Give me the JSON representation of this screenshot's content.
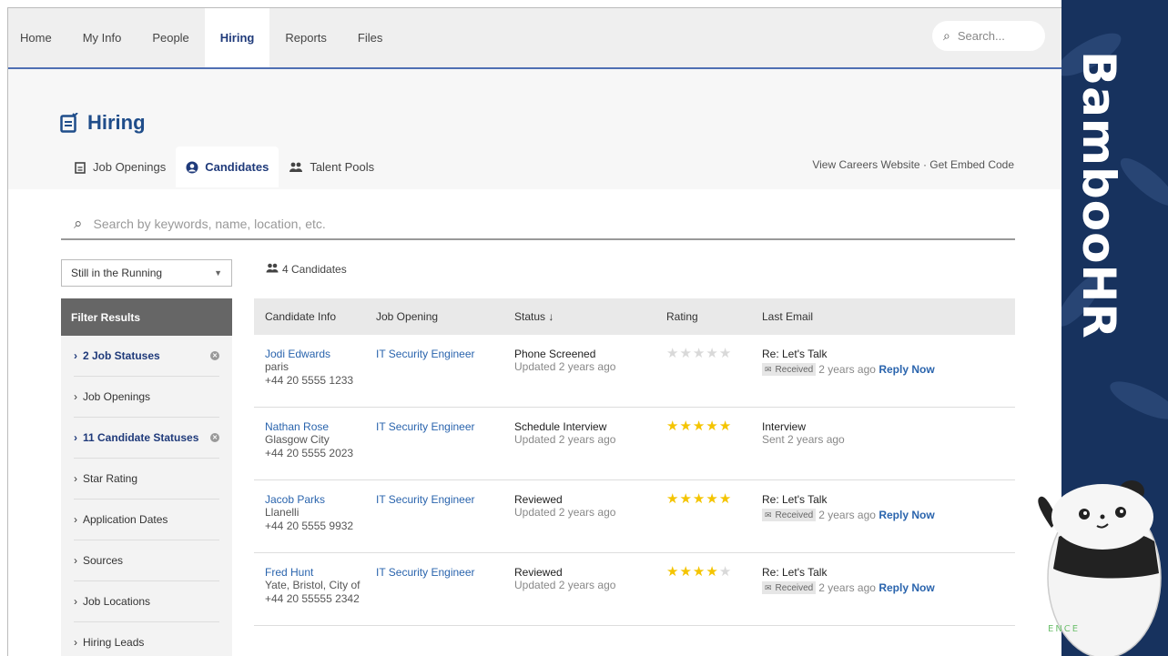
{
  "nav": {
    "items": [
      "Home",
      "My Info",
      "People",
      "Hiring",
      "Reports",
      "Files"
    ],
    "active": "Hiring",
    "search_placeholder": "Search..."
  },
  "page": {
    "title": "Hiring",
    "tabs": [
      {
        "label": "Job Openings",
        "icon": "job-openings-icon"
      },
      {
        "label": "Candidates",
        "icon": "candidate-icon"
      },
      {
        "label": "Talent Pools",
        "icon": "talent-pools-icon"
      }
    ],
    "active_tab": "Candidates",
    "link_careers": "View Careers Website",
    "link_separator": "·",
    "link_embed": "Get Embed Code"
  },
  "search": {
    "placeholder": "Search by keywords, name, location, etc."
  },
  "filter": {
    "dropdown_value": "Still in the Running",
    "header": "Filter Results",
    "items": [
      {
        "label": "2 Job Statuses",
        "active": true
      },
      {
        "label": "Job Openings",
        "active": false
      },
      {
        "label": "11 Candidate Statuses",
        "active": true
      },
      {
        "label": "Star Rating",
        "active": false
      },
      {
        "label": "Application Dates",
        "active": false
      },
      {
        "label": "Sources",
        "active": false
      },
      {
        "label": "Job Locations",
        "active": false
      },
      {
        "label": "Hiring Leads",
        "active": false
      }
    ]
  },
  "candidates": {
    "count_label": "4 Candidates",
    "columns": [
      "Candidate Info",
      "Job Opening",
      "Status ↓",
      "Rating",
      "Last Email"
    ],
    "rows": [
      {
        "name": "Jodi Edwards",
        "location": "paris",
        "phone": "+44 20 5555 1233",
        "job": "IT Security Engineer",
        "status": "Phone Screened",
        "status_updated": "Updated 2 years ago",
        "rating": 0,
        "email_subject": "Re: Let's Talk",
        "email_badge": "Received",
        "email_time": "2 years ago",
        "email_action": "Reply Now"
      },
      {
        "name": "Nathan Rose",
        "location": "Glasgow City",
        "phone": "+44 20 5555 2023",
        "job": "IT Security Engineer",
        "status": "Schedule Interview",
        "status_updated": "Updated 2 years ago",
        "rating": 5,
        "email_subject": "Interview",
        "email_badge": "",
        "email_time": "Sent 2 years ago",
        "email_action": ""
      },
      {
        "name": "Jacob Parks",
        "location": "Llanelli",
        "phone": "+44 20 5555 9932",
        "job": "IT Security Engineer",
        "status": "Reviewed",
        "status_updated": "Updated 2 years ago",
        "rating": 5,
        "email_subject": "Re: Let's Talk",
        "email_badge": "Received",
        "email_time": "2 years ago",
        "email_action": "Reply Now"
      },
      {
        "name": "Fred Hunt",
        "location": "Yate, Bristol, City of",
        "phone": "+44 20 55555 2342",
        "job": "IT Security Engineer",
        "status": "Reviewed",
        "status_updated": "Updated 2 years ago",
        "rating": 4,
        "email_subject": "Re: Let's Talk",
        "email_badge": "Received",
        "email_time": "2 years ago",
        "email_action": "Reply Now"
      }
    ]
  },
  "brand": {
    "name": "BambooHR",
    "mascot_caption": "ENCE",
    "colors": {
      "panel": "#17325e",
      "accent_blue": "#2a64ad",
      "star": "#f4c400"
    }
  }
}
